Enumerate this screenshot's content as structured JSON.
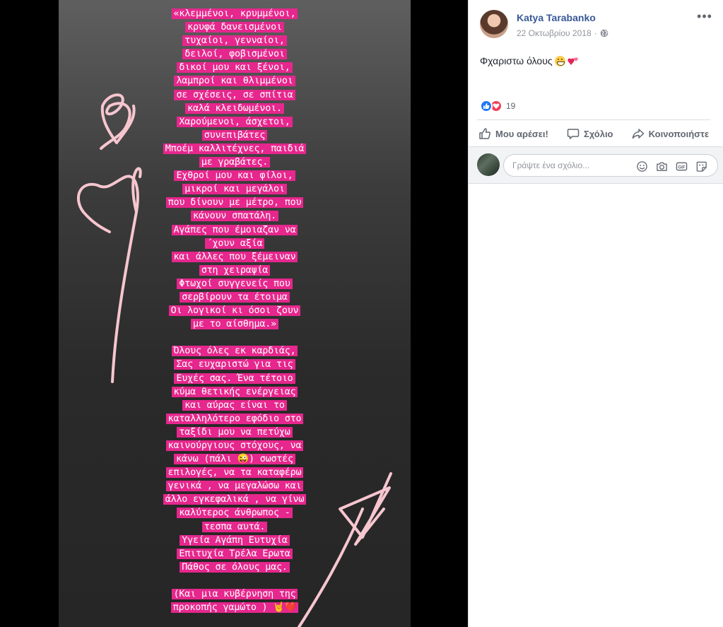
{
  "story": {
    "lines": [
      "«κλεμμένοι, κρυμμένοι,",
      "κρυφά δανεισμένοι",
      "τυχαίοι, γενναίοι,",
      "δειλοί, φοβισμένοι",
      "δικοί μου και ξένοι,",
      "λαμπροί και θλιμμένοι",
      "σε σχέσεις, σε σπίτια",
      "καλά κλειδωμένοι.",
      "Χαρούμενοι, άσχετοι,",
      "συνεπιβάτες",
      "Μποέμ καλλιτέχνες, παιδιά",
      "με γραβάτες.",
      "Εχθροί μου και φίλοι,",
      "μικροί και μεγάλοι",
      "που δίνουν με μέτρο, που",
      "κάνουν σπατάλη.",
      "Αγάπες που έμοιαζαν να",
      "΄χουν αξία",
      "και άλλες που ξέμειναν",
      "στη χειραψία",
      "Φτωχοί συγγενείς που",
      "σερβίρουν τα έτοιμα",
      "Οι λογικοί κι όσοι ζουν",
      "με το αίσθημα.»",
      "",
      "Όλους όλες εκ καρδιάς,",
      "Σας ευχαριστώ για τις",
      "Ευχές σας. Ένα τέτοιο",
      "κύμα θετικής ενέργειας",
      "και αύρας είναι το",
      "καταλληλότερο εφόδιο στο",
      "ταξίδι μου να πετύχω",
      "καινούργιους στόχους, να",
      "κάνω (πάλι 😜) σωστές",
      "επιλογές, να τα καταφέρω",
      "γενικά , να μεγαλώσω και",
      "άλλο εγκεφαλικά , να γίνω",
      "καλύτερος άνθρωπος  -",
      "τεσπα αυτά.",
      "Υγεία Αγάπη Ευτυχία",
      "Επιτυχία Τρέλα Ερωτα",
      "Πάθος σε όλους μας.",
      "",
      "(Και μια κυβέρνηση της",
      "προκοπής γαμώτο ) 🤘❤️"
    ]
  },
  "post": {
    "author": "Katya Tarabanko",
    "date": "22 Οκτωβρίου 2018",
    "privacy_icon": "globe-icon",
    "more_label": "•••",
    "caption": "Φχαριστω όλους",
    "reaction_count": "19",
    "actions": {
      "like": "Μου αρέσει!",
      "comment": "Σχόλιο",
      "share": "Κοινοποιήστε"
    },
    "comment_placeholder": "Γράψτε ένα σχόλιο...",
    "gif_label": "GIF"
  },
  "colors": {
    "highlight": "#e6278d",
    "link": "#385898",
    "like_blue": "#2078f4",
    "love_red": "#f33e58"
  }
}
